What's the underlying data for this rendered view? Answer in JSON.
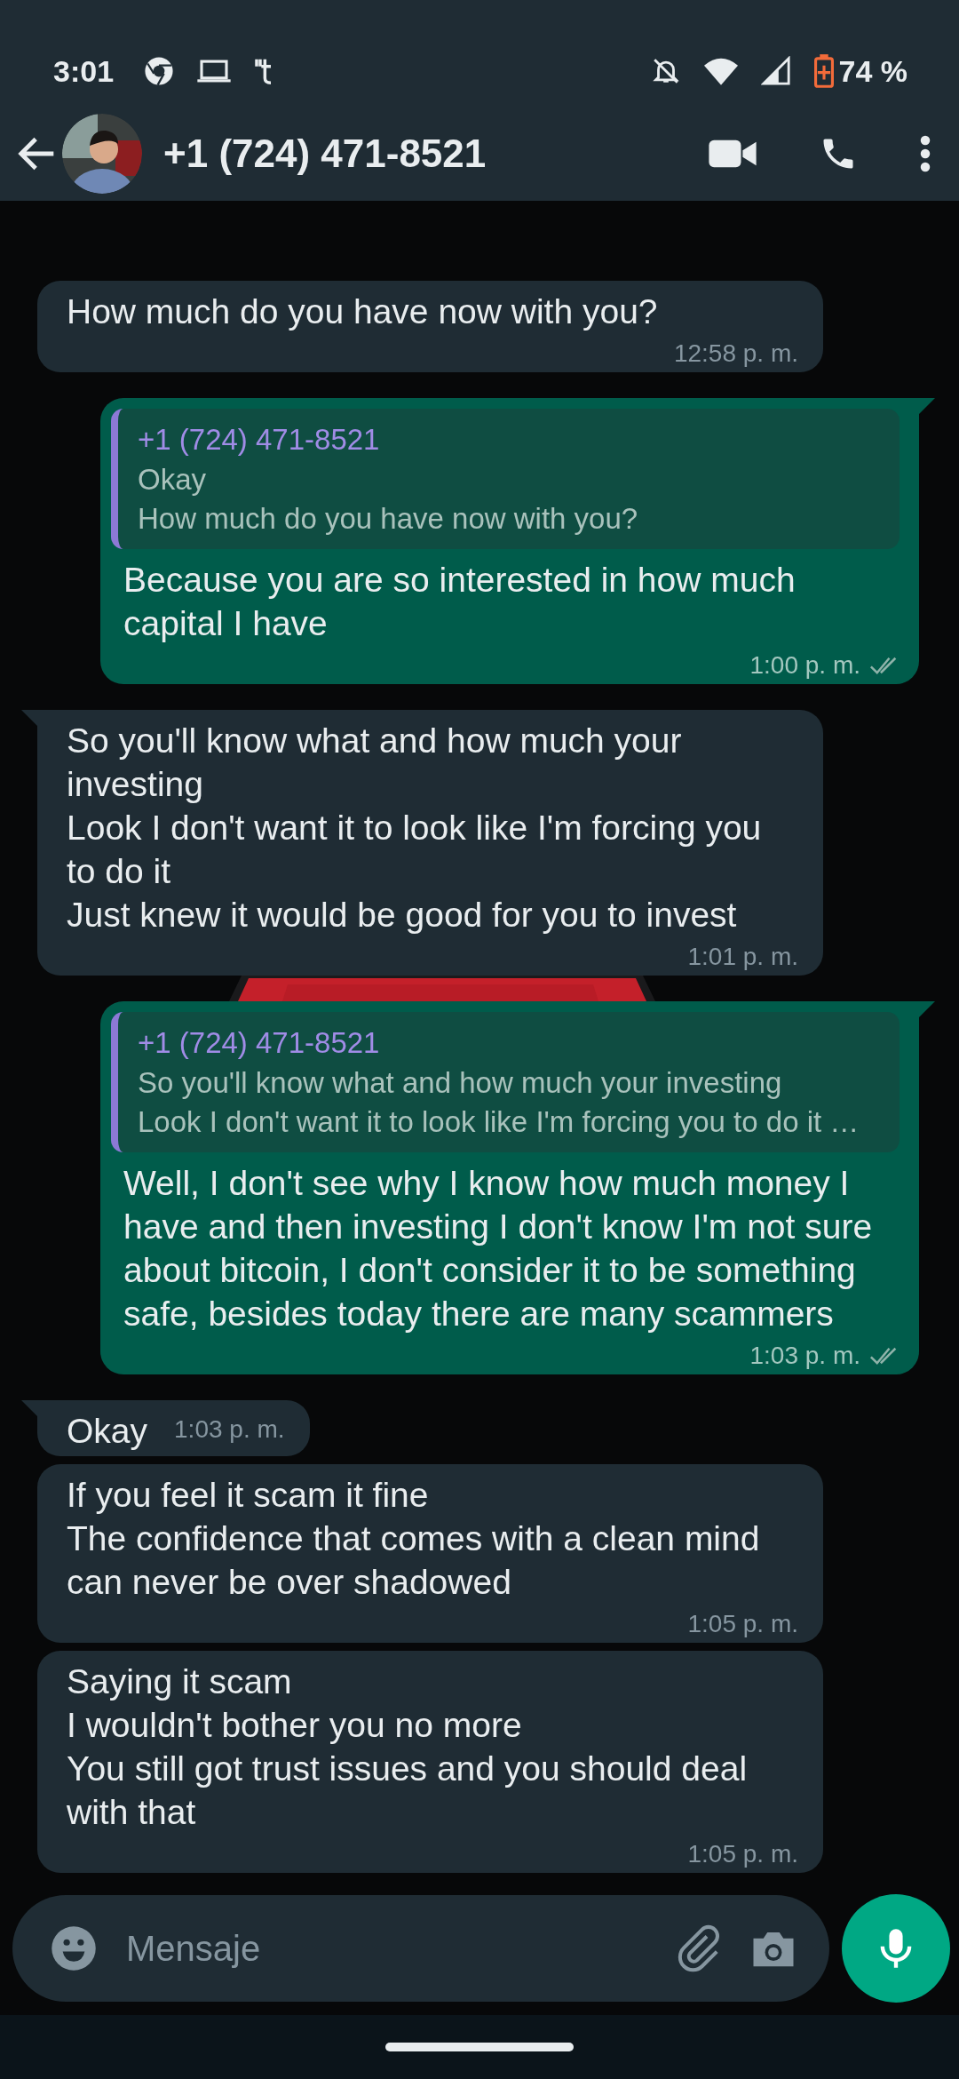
{
  "status_bar": {
    "time": "3:01",
    "battery": "74 %"
  },
  "header": {
    "title": "+1 (724) 471-8521"
  },
  "messages": [
    {
      "kind": "incoming",
      "tail": false,
      "text": "How much do you have now with you?",
      "time": "12:58 p. m."
    },
    {
      "kind": "outgoing",
      "tail": true,
      "quote": {
        "author": "+1 (724) 471-8521",
        "text": "Okay\nHow much do you have now with you?"
      },
      "text": "Because you are so interested in how much capital I have",
      "time": "1:00 p. m.",
      "read": false
    },
    {
      "kind": "incoming",
      "tail": true,
      "text": "So you'll know what and how much your investing\nLook I don't want it to look like I'm forcing you to do it\nJust knew it would be good for you to invest",
      "time": "1:01 p. m."
    },
    {
      "kind": "outgoing",
      "tail": true,
      "quote": {
        "author": "+1 (724) 471-8521",
        "text": "So you'll know what and how much your investing\nLook I don't want it to look like I'm forcing you to do it …"
      },
      "text": "Well, I don't see why I know how much money I have and then investing I don't know I'm not sure about bitcoin, I don't consider it to be something safe, besides today there are many scammers",
      "time": "1:03 p. m.",
      "read": false
    },
    {
      "kind": "incoming",
      "tail": true,
      "text": "Okay",
      "time": "1:03 p. m."
    },
    {
      "kind": "incoming",
      "tail": false,
      "text": "If you feel it scam it fine\nThe confidence that comes with a clean mind can never be over shadowed",
      "time": "1:05 p. m."
    },
    {
      "kind": "incoming",
      "tail": false,
      "text": "Saying it scam\nI wouldn't bother you no more\nYou still got trust issues and you should deal with that",
      "time": "1:05 p. m."
    }
  ],
  "composer": {
    "placeholder": "Mensaje"
  }
}
